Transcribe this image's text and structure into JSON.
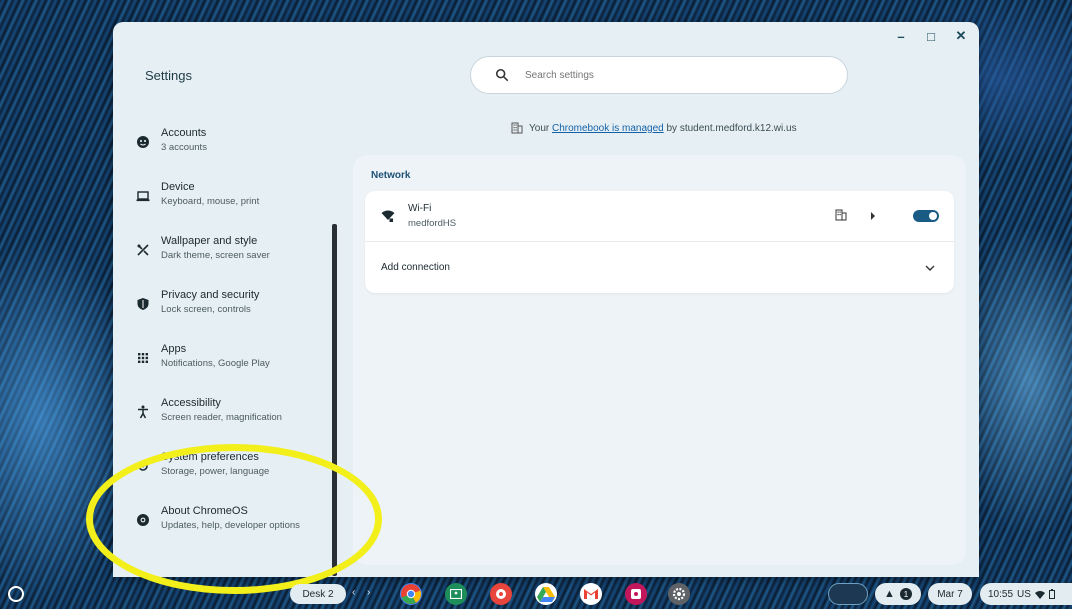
{
  "window": {
    "minimize": "–",
    "maximize": "□",
    "close": "✕"
  },
  "app_title": "Settings",
  "search": {
    "placeholder": "Search settings"
  },
  "managed_notice": {
    "prefix": "Your ",
    "link": "Chromebook is managed",
    "suffix": " by student.medford.k12.wi.us"
  },
  "sidebar": {
    "items": [
      {
        "label": "Accounts",
        "sub": "3 accounts",
        "icon": "account-icon"
      },
      {
        "label": "Device",
        "sub": "Keyboard, mouse, print",
        "icon": "laptop-icon"
      },
      {
        "label": "Wallpaper and style",
        "sub": "Dark theme, screen saver",
        "icon": "palette-icon"
      },
      {
        "label": "Privacy and security",
        "sub": "Lock screen, controls",
        "icon": "shield-icon"
      },
      {
        "label": "Apps",
        "sub": "Notifications, Google Play",
        "icon": "apps-grid-icon"
      },
      {
        "label": "Accessibility",
        "sub": "Screen reader, magnification",
        "icon": "accessibility-icon"
      },
      {
        "label": "System preferences",
        "sub": "Storage, power, language",
        "icon": "system-prefs-icon"
      },
      {
        "label": "About ChromeOS",
        "sub": "Updates, help, developer options",
        "icon": "chromeos-icon"
      }
    ]
  },
  "network": {
    "title": "Network",
    "wifi": {
      "label": "Wi-Fi",
      "network": "medfordHS",
      "enabled": true
    },
    "add_connection": "Add connection"
  },
  "shelf": {
    "desk": "Desk 2",
    "prev": "‹",
    "next": "›",
    "apps": [
      {
        "name": "chrome-icon",
        "color": "#4285f4"
      },
      {
        "name": "classroom-icon",
        "color": "#1e8e5a"
      },
      {
        "name": "canvas-icon",
        "color": "#e8453c"
      },
      {
        "name": "drive-icon",
        "color": "#34a853"
      },
      {
        "name": "gmail-icon",
        "color": "#ea4335"
      },
      {
        "name": "screencast-icon",
        "color": "#c2185b"
      },
      {
        "name": "settings-icon",
        "color": "#5f6368"
      }
    ],
    "notification_count": "1",
    "date": "Mar 7",
    "time": "10:55",
    "locale": "US"
  },
  "colors": {
    "accent": "#1a5b85",
    "highlight": "#f2ef1b",
    "link": "#1561a8"
  }
}
